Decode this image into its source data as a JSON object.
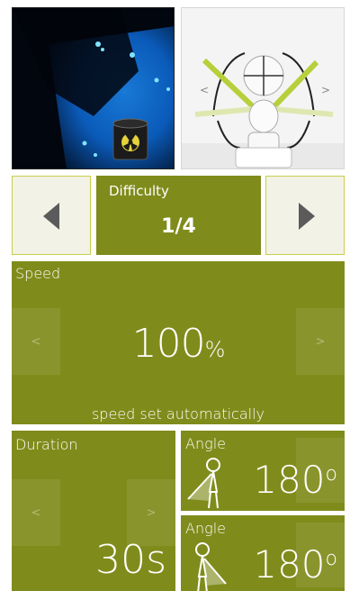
{
  "images": {
    "game_screenshot_icon": "radiation-barrel-icon",
    "figure_icon": "stretching-figure-icon"
  },
  "difficulty": {
    "title": "Difficulty",
    "value": "1/4",
    "prev_icon": "triangle-left-icon",
    "next_icon": "triangle-right-icon"
  },
  "speed": {
    "title": "Speed",
    "value": "100",
    "unit": "%",
    "note": "speed set automatically",
    "dec_glyph": "<",
    "inc_glyph": ">"
  },
  "duration": {
    "title": "Duration",
    "value": "30s",
    "dec_glyph": "<",
    "inc_glyph": ">"
  },
  "angles": [
    {
      "title": "Angle",
      "value": "180",
      "unit": "o"
    },
    {
      "title": "Angle",
      "value": "180",
      "unit": "o"
    }
  ],
  "colors": {
    "accent": "#7f8c1b",
    "arrow_tile_bg": "#f3f2e6",
    "arrow": "#5b5b5b"
  }
}
